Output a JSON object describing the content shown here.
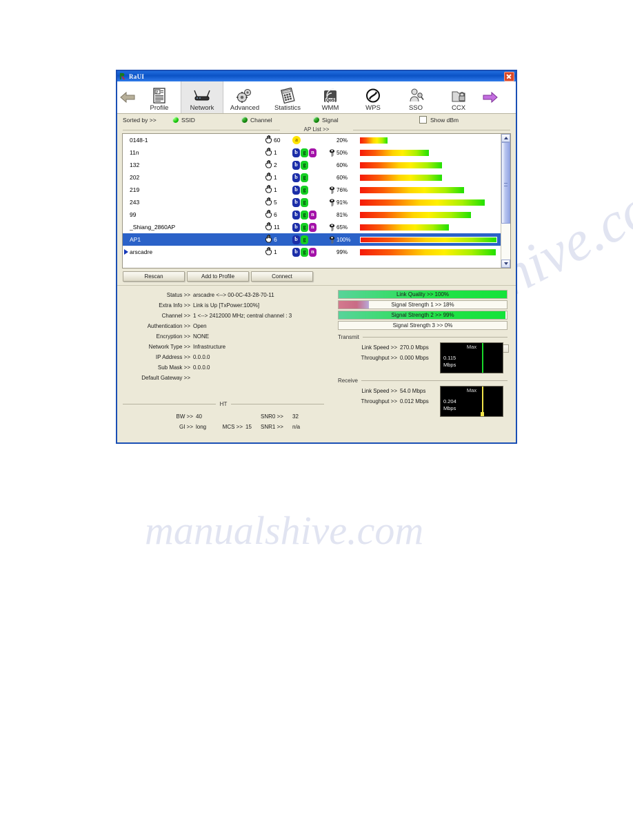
{
  "window": {
    "title": "RaUI",
    "close_label": "×"
  },
  "toolbar": {
    "back_icon": "left-arrow-icon",
    "forward_icon": "right-arrow-icon",
    "tabs": [
      {
        "label": "Profile",
        "icon": "profile-icon",
        "active": false
      },
      {
        "label": "Network",
        "icon": "network-icon",
        "active": true
      },
      {
        "label": "Advanced",
        "icon": "gears-icon",
        "active": false
      },
      {
        "label": "Statistics",
        "icon": "statistics-icon",
        "active": false
      },
      {
        "label": "WMM",
        "icon": "qos-icon",
        "active": false
      },
      {
        "label": "WPS",
        "icon": "wps-icon",
        "active": false
      },
      {
        "label": "SSO",
        "icon": "sso-icon",
        "active": false
      },
      {
        "label": "CCX",
        "icon": "ccx-icon",
        "active": false
      }
    ]
  },
  "sortbar": {
    "label": "Sorted by >>",
    "options": [
      {
        "label": "SSID",
        "selected": true
      },
      {
        "label": "Channel",
        "selected": false
      },
      {
        "label": "Signal",
        "selected": false
      }
    ],
    "show_dbm": {
      "label": "Show dBm",
      "checked": false
    }
  },
  "ap_list": {
    "caption": "AP List >>",
    "rows": [
      {
        "ssid": "0148-1",
        "channel": "60",
        "modes": [
          "a"
        ],
        "secured": false,
        "signal": "20%",
        "pct": 20,
        "selected": false,
        "current": false
      },
      {
        "ssid": "11n",
        "channel": "1",
        "modes": [
          "b",
          "g",
          "n"
        ],
        "secured": true,
        "signal": "50%",
        "pct": 50,
        "selected": false,
        "current": false
      },
      {
        "ssid": "132",
        "channel": "2",
        "modes": [
          "b",
          "g"
        ],
        "secured": false,
        "signal": "60%",
        "pct": 60,
        "selected": false,
        "current": false
      },
      {
        "ssid": "202",
        "channel": "1",
        "modes": [
          "b",
          "g"
        ],
        "secured": false,
        "signal": "60%",
        "pct": 60,
        "selected": false,
        "current": false
      },
      {
        "ssid": "219",
        "channel": "1",
        "modes": [
          "b",
          "g"
        ],
        "secured": true,
        "signal": "76%",
        "pct": 76,
        "selected": false,
        "current": false
      },
      {
        "ssid": "243",
        "channel": "5",
        "modes": [
          "b",
          "g"
        ],
        "secured": true,
        "signal": "91%",
        "pct": 91,
        "selected": false,
        "current": false
      },
      {
        "ssid": "99",
        "channel": "6",
        "modes": [
          "b",
          "g",
          "n"
        ],
        "secured": false,
        "signal": "81%",
        "pct": 81,
        "selected": false,
        "current": false
      },
      {
        "ssid": "_Shiang_2860AP",
        "channel": "11",
        "modes": [
          "b",
          "g",
          "n"
        ],
        "secured": true,
        "signal": "65%",
        "pct": 65,
        "selected": false,
        "current": false
      },
      {
        "ssid": "AP1",
        "channel": "6",
        "modes": [
          "b",
          "g"
        ],
        "secured": true,
        "signal": "100%",
        "pct": 100,
        "selected": true,
        "current": false
      },
      {
        "ssid": "arscadre",
        "channel": "1",
        "modes": [
          "b",
          "g",
          "n"
        ],
        "secured": false,
        "signal": "99%",
        "pct": 99,
        "selected": false,
        "current": true
      }
    ]
  },
  "buttons": {
    "rescan": "Rescan",
    "add_to_profile": "Add to Profile",
    "connect": "Connect"
  },
  "status": {
    "rows": [
      {
        "label": "Status >>",
        "value": "arscadre <--> 00-0C-43-28-70-11"
      },
      {
        "label": "Extra Info >>",
        "value": "Link is Up [TxPower:100%]"
      },
      {
        "label": "Channel >>",
        "value": "1 <--> 2412000 MHz; central channel : 3"
      },
      {
        "label": "Authentication >>",
        "value": "Open"
      },
      {
        "label": "Encryption >>",
        "value": "NONE"
      },
      {
        "label": "Network Type >>",
        "value": "Infrastructure"
      },
      {
        "label": "IP Address >>",
        "value": "0.0.0.0"
      },
      {
        "label": "Sub Mask >>",
        "value": "0.0.0.0"
      },
      {
        "label": "Default Gateway >>",
        "value": ""
      }
    ]
  },
  "ht": {
    "title": "HT",
    "bw_label": "BW >>",
    "bw_value": "40",
    "gi_label": "GI >>",
    "gi_value": "long",
    "mcs_label": "MCS >>",
    "mcs_value": "15",
    "snr0_label": "SNR0 >>",
    "snr0_value": "32",
    "snr1_label": "SNR1 >>",
    "snr1_value": "n/a"
  },
  "metrics": {
    "bars": [
      {
        "label": "Link Quality >> 100%",
        "pct": 100,
        "style": "green"
      },
      {
        "label": "Signal Strength 1 >> 18%",
        "pct": 18,
        "style": "pink"
      },
      {
        "label": "Signal Strength 2 >> 99%",
        "pct": 99,
        "style": "green"
      },
      {
        "label": "Signal Strength 3 >> 0%",
        "pct": 0,
        "style": "none"
      }
    ],
    "transmit": {
      "title": "Transmit",
      "link_speed_label": "Link Speed >>",
      "link_speed_value": "270.0 Mbps",
      "throughput_label": "Throughput >>",
      "throughput_value": "0.000 Mbps",
      "graph_max": "Max",
      "graph_value": "0.115",
      "graph_unit": "Mbps",
      "graph_color": "#18d82a"
    },
    "receive": {
      "title": "Receive",
      "link_speed_label": "Link Speed >>",
      "link_speed_value": "54.0 Mbps",
      "throughput_label": "Throughput >>",
      "throughput_value": "0.012 Mbps",
      "graph_max": "Max",
      "graph_value": "0.204",
      "graph_unit": "Mbps",
      "graph_color": "#f0e34a"
    }
  },
  "watermark": {
    "line1": "manualshive.com",
    "line2": "manualshive.com"
  }
}
